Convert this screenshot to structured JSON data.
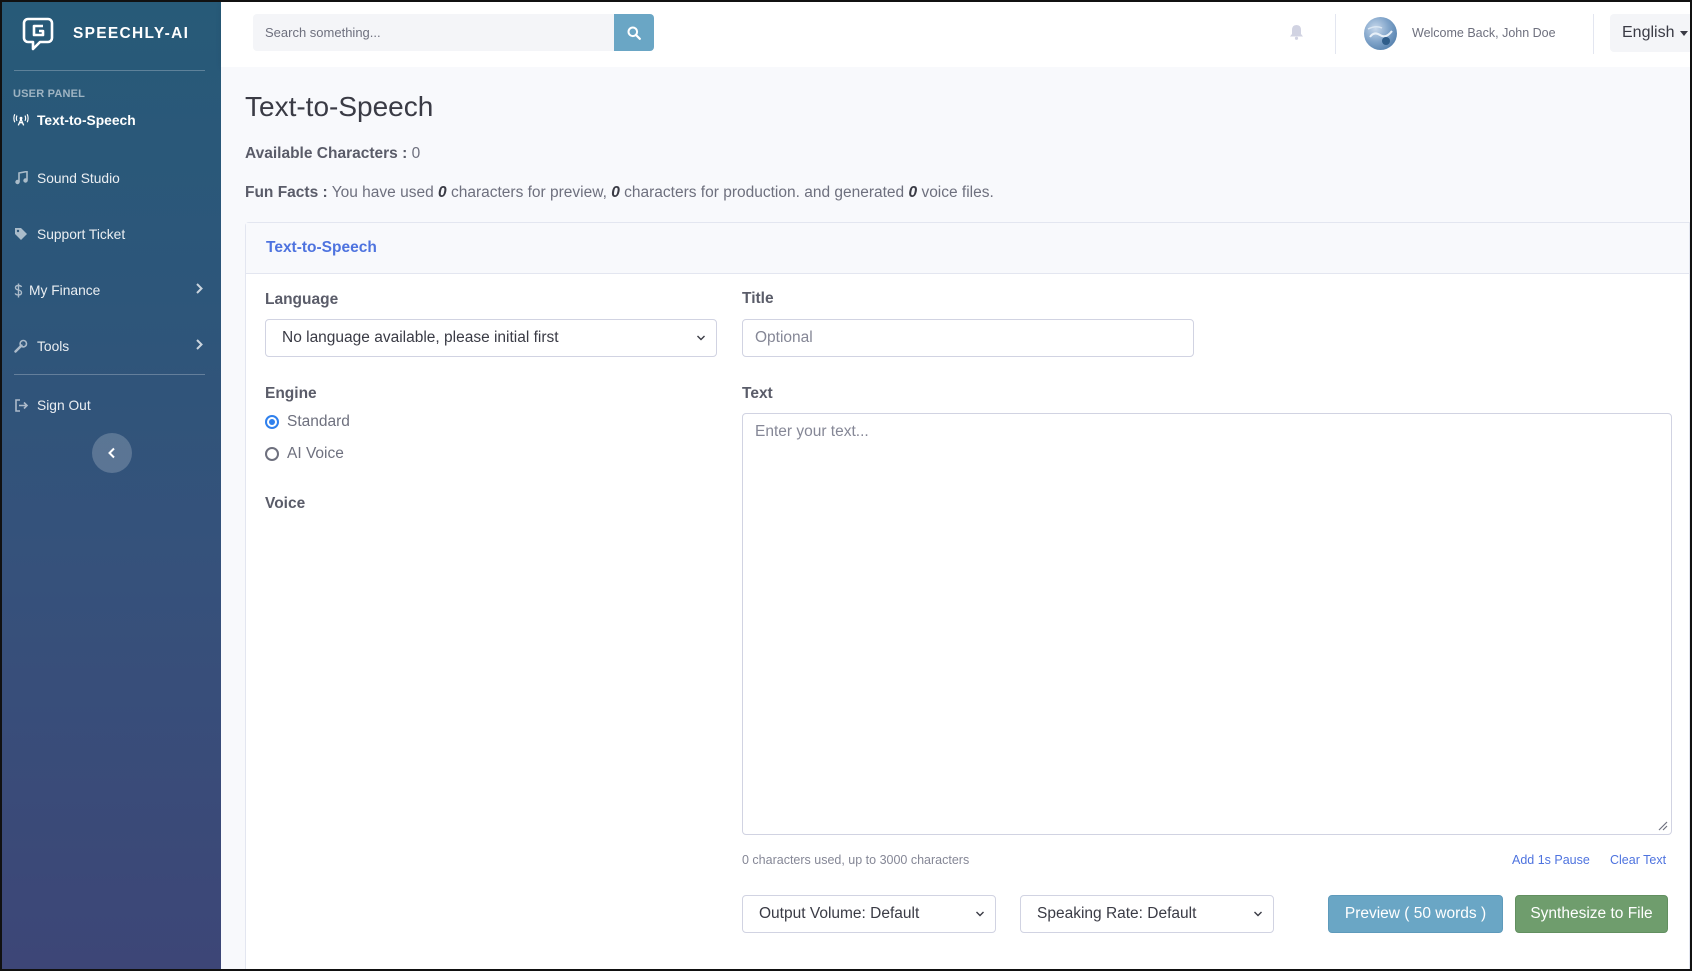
{
  "brand": {
    "name": "SPEECHLY-AI"
  },
  "sidebar": {
    "heading": "USER PANEL",
    "items": [
      {
        "label": "Text-to-Speech",
        "icon": "broadcast-icon",
        "active": true
      },
      {
        "label": "Sound Studio",
        "icon": "music-note-icon"
      },
      {
        "label": "Support Ticket",
        "icon": "tag-icon"
      },
      {
        "label": "My Finance",
        "icon": "dollar-icon",
        "has_submenu": true
      },
      {
        "label": "Tools",
        "icon": "wrench-icon",
        "has_submenu": true
      }
    ],
    "sign_out": "Sign Out"
  },
  "topbar": {
    "search_placeholder": "Search something...",
    "welcome": "Welcome Back, John Doe",
    "language": "English"
  },
  "page": {
    "title": "Text-to-Speech",
    "available_label": "Available Characters :",
    "available_value": "0",
    "facts_label": "Fun Facts :",
    "facts_t1": "You have used",
    "facts_n1": "0",
    "facts_t2": "characters for preview,",
    "facts_n2": "0",
    "facts_t3": "characters for production. and generated",
    "facts_n3": "0",
    "facts_t4": "voice files."
  },
  "card": {
    "header": "Text-to-Speech",
    "language_label": "Language",
    "language_value": "No language available, please initial first",
    "title_label": "Title",
    "title_placeholder": "Optional",
    "engine_label": "Engine",
    "engine_options": [
      {
        "label": "Standard",
        "checked": true
      },
      {
        "label": "AI Voice",
        "checked": false
      }
    ],
    "voice_label": "Voice",
    "text_label": "Text",
    "text_placeholder": "Enter your text...",
    "char_count": "0 characters used, up to 3000 characters",
    "add_pause": "Add 1s Pause",
    "clear_text": "Clear Text",
    "volume": "Output Volume: Default",
    "rate": "Speaking Rate: Default",
    "preview_btn": "Preview ( 50 words )",
    "synth_btn": "Synthesize to File"
  },
  "colors": {
    "sidebar_top": "#275a78",
    "sidebar_bottom": "#3d4677",
    "primary": "#4e73df",
    "info": "#6aa6c5",
    "success": "#6f9d6d"
  }
}
